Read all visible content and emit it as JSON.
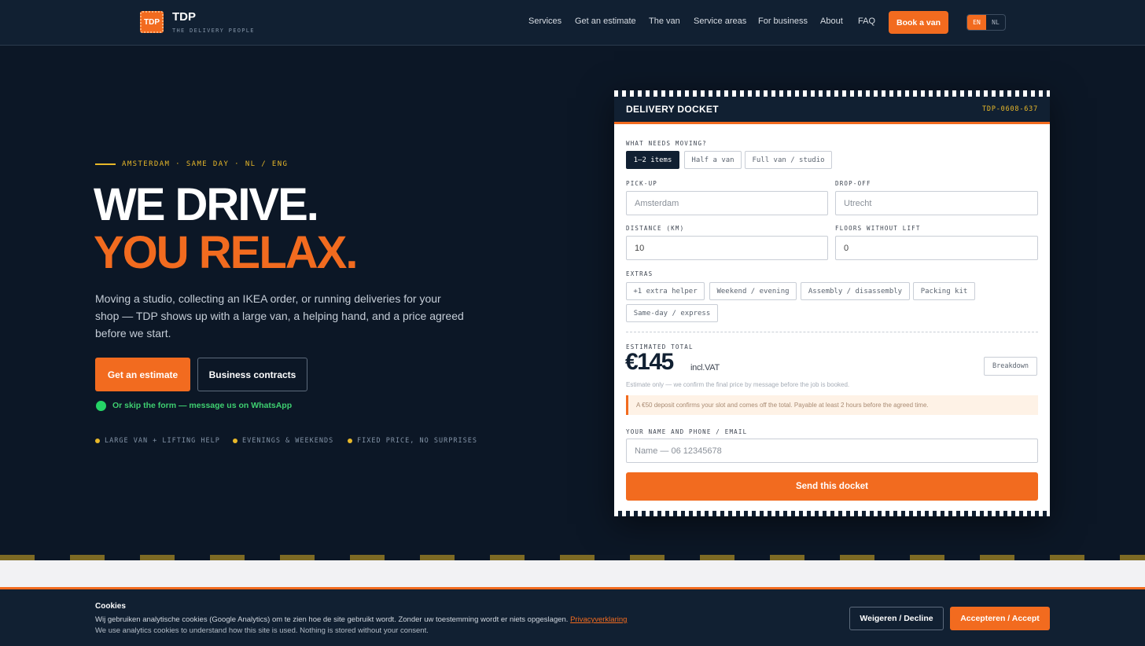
{
  "header": {
    "logo_text": "TDP",
    "brand": "TDP",
    "tagline": "THE DELIVERY PEOPLE",
    "nav": [
      "Services",
      "Get an estimate",
      "The van",
      "Service areas",
      "For business",
      "About",
      "FAQ"
    ],
    "book_label": "Book a van",
    "lang": [
      "EN",
      "NL"
    ]
  },
  "hero": {
    "eyebrow": "AMSTERDAM · SAME DAY · NL / ENG",
    "headline_1": "WE DRIVE.",
    "headline_2": "YOU RELAX.",
    "lead": "Moving a studio, collecting an IKEA order, or running deliveries for your shop — TDP shows up with a large van, a helping hand, and a price agreed before we start.",
    "primary_cta": "Get an estimate",
    "secondary_cta": "Business contracts",
    "whatsapp": "Or skip the form — message us on WhatsApp",
    "features": [
      "LARGE VAN + LIFTING HELP",
      "EVENINGS & WEEKENDS",
      "FIXED PRICE, NO SURPRISES"
    ]
  },
  "docket": {
    "title": "DELIVERY DOCKET",
    "id": "TDP-0608-637",
    "moving_label": "WHAT NEEDS MOVING?",
    "moving_options": [
      "1–2 items",
      "Half a van",
      "Full van / studio"
    ],
    "pickup_label": "PICK-UP",
    "pickup_placeholder": "Amsterdam",
    "dropoff_label": "DROP-OFF",
    "dropoff_placeholder": "Utrecht",
    "distance_label": "DISTANCE (KM)",
    "distance_value": "10",
    "floors_label": "FLOORS WITHOUT LIFT",
    "floors_value": "0",
    "extras_label": "EXTRAS",
    "extras": [
      "+1 extra helper",
      "Weekend / evening",
      "Assembly / disassembly",
      "Packing kit",
      "Same-day / express"
    ],
    "total_label": "ESTIMATED TOTAL",
    "price": "€145",
    "vat": "incl.VAT",
    "breakdown": "Breakdown",
    "note": "Estimate only — we confirm the final price by message before the job is booked.",
    "deposit": "A €50 deposit confirms your slot and comes off the total. Payable at least 2 hours before the agreed time.",
    "contact_label": "YOUR NAME AND PHONE / EMAIL",
    "contact_placeholder": "Name — 06 12345678",
    "send": "Send this docket"
  },
  "cookies": {
    "title": "Cookies",
    "nl_text": "Wij gebruiken analytische cookies (Google Analytics) om te zien hoe de site gebruikt wordt. Zonder uw toestemming wordt er niets opgeslagen.",
    "privacy_link": "Privacyverklaring",
    "en_text": "We use analytics cookies to understand how this site is used. Nothing is stored without your consent.",
    "decline": "Weigeren / Decline",
    "accept": "Accepteren / Accept"
  },
  "colors": {
    "accent": "#f26b1f",
    "navy": "#0c1726",
    "gold": "#e8b829",
    "whatsapp": "#25d366"
  }
}
